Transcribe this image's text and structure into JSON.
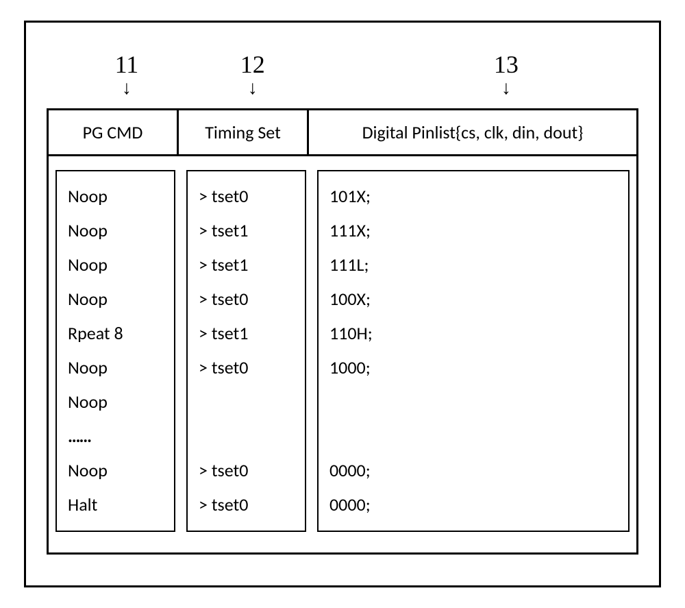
{
  "labels": {
    "col1": "11",
    "col2": "12",
    "col3": "13"
  },
  "headers": {
    "cmd": "PG CMD",
    "timing": "Timing Set",
    "pinlist": "Digital Pinlist{cs, clk, din, dout}"
  },
  "rows": [
    {
      "cmd": "Noop",
      "timing": "> tset0",
      "pinlist": "101X;"
    },
    {
      "cmd": "Noop",
      "timing": "> tset1",
      "pinlist": "111X;"
    },
    {
      "cmd": "Noop",
      "timing": "> tset1",
      "pinlist": "111L;"
    },
    {
      "cmd": "Noop",
      "timing": "> tset0",
      "pinlist": "100X;"
    },
    {
      "cmd": "Rpeat 8",
      "timing": "> tset1",
      "pinlist": "110H;"
    },
    {
      "cmd": "Noop",
      "timing": "> tset0",
      "pinlist": "1000;"
    },
    {
      "cmd": "Noop",
      "timing": "",
      "pinlist": ""
    },
    {
      "cmd": "……",
      "timing": "",
      "pinlist": ""
    },
    {
      "cmd": "Noop",
      "timing": "> tset0",
      "pinlist": "0000;"
    },
    {
      "cmd": "Halt",
      "timing": "> tset0",
      "pinlist": "0000;"
    }
  ]
}
